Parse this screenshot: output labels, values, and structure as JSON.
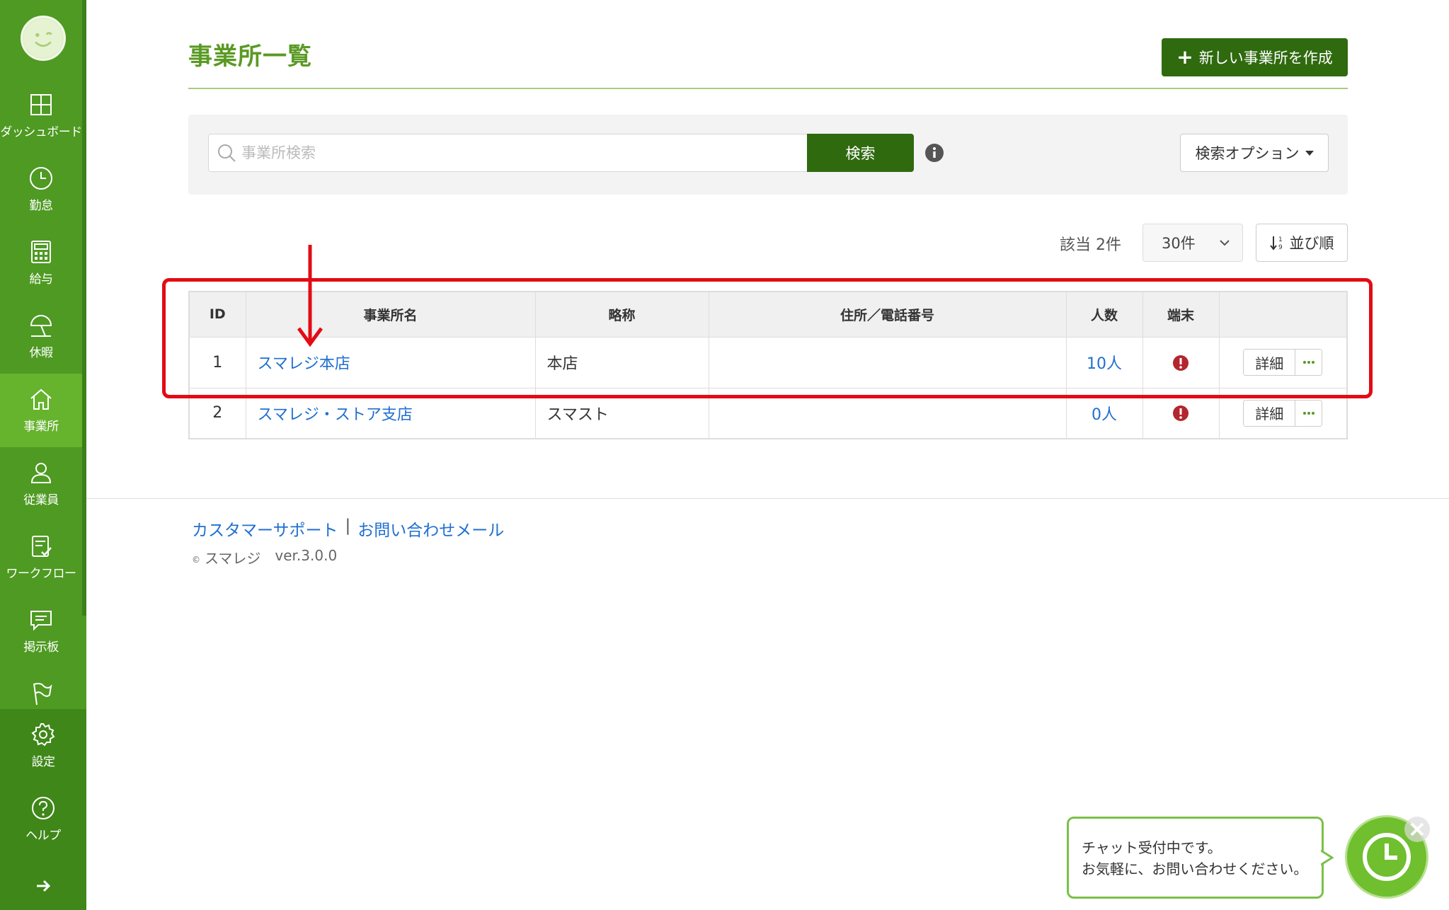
{
  "sidebar": {
    "items": [
      {
        "label": "ダッシュボード",
        "icon": "dashboard-icon"
      },
      {
        "label": "勤怠",
        "icon": "clock-icon"
      },
      {
        "label": "給与",
        "icon": "calculator-icon"
      },
      {
        "label": "休暇",
        "icon": "parasol-icon"
      },
      {
        "label": "事業所",
        "icon": "home-icon"
      },
      {
        "label": "従業員",
        "icon": "user-icon"
      },
      {
        "label": "ワークフロー",
        "icon": "clipboard-check-icon"
      },
      {
        "label": "掲示板",
        "icon": "message-icon"
      },
      {
        "label": "",
        "icon": "flag-icon"
      }
    ],
    "bottom_items": [
      {
        "label": "設定",
        "icon": "gear-icon"
      },
      {
        "label": "ヘルプ",
        "icon": "help-icon"
      }
    ],
    "active_color": "#66b32e"
  },
  "header": {
    "title": "事業所一覧",
    "create_button": "新しい事業所を作成"
  },
  "search": {
    "placeholder": "事業所検索",
    "value": "",
    "button": "検索",
    "options_button": "検索オプション"
  },
  "results": {
    "count_label": "該当 2件",
    "per_page": "30件",
    "sort_button": "並び順"
  },
  "table": {
    "headers": [
      "ID",
      "事業所名",
      "略称",
      "住所／電話番号",
      "人数",
      "端末",
      ""
    ],
    "rows": [
      {
        "id": "1",
        "name": "スマレジ本店",
        "abbr": "本店",
        "address": "",
        "people": "10人",
        "detail": "詳細"
      },
      {
        "id": "2",
        "name": "スマレジ・ストア支店",
        "abbr": "スマスト",
        "address": "",
        "people": "0人",
        "detail": "詳細"
      }
    ]
  },
  "footer": {
    "support_link": "カスタマーサポート",
    "separator": "|",
    "contact_link": "お問い合わせメール",
    "copyright": "スマレジ",
    "copyright_mark": "©",
    "version": "ver.3.0.0"
  },
  "chat": {
    "line1": "チャット受付中です。",
    "line2": "お気軽に、お問い合わせください。"
  },
  "colors": {
    "brand_green": "#4e9a22",
    "button_dark_green": "#2f6a0f",
    "link_blue": "#1f6fd1",
    "annotation_red": "#e30b14",
    "alert_red": "#b3262d"
  }
}
